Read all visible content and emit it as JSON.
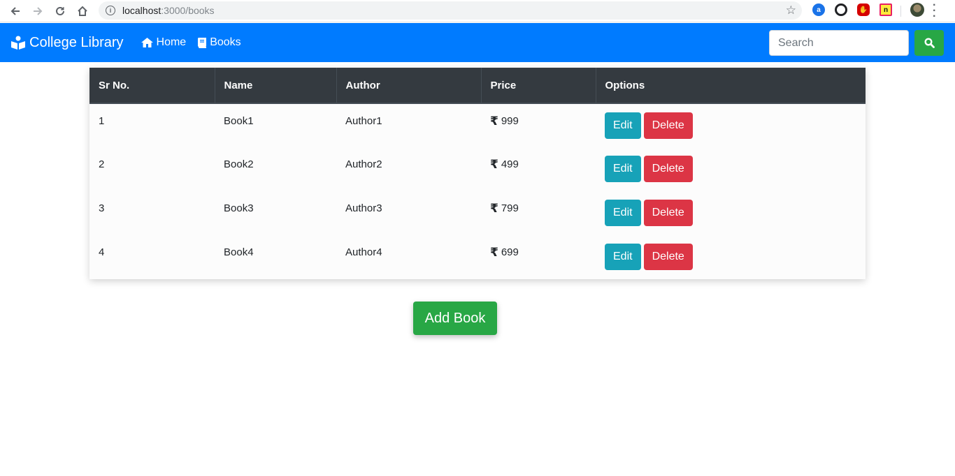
{
  "browser": {
    "url_host": "localhost",
    "url_path": ":3000/books",
    "back_icon": "back-arrow-icon",
    "forward_icon": "forward-arrow-icon",
    "reload_icon": "reload-icon",
    "home_icon": "home-icon",
    "info_icon": "info-icon",
    "bookmark_icon": "star-icon",
    "extension_1_label": "a",
    "extension_4_label": "n"
  },
  "navbar": {
    "brand": "College Library",
    "links": [
      {
        "label": "Home",
        "icon": "home-icon"
      },
      {
        "label": "Books",
        "icon": "book-icon"
      }
    ],
    "search": {
      "placeholder": "Search",
      "value": ""
    },
    "accent": "#007bff"
  },
  "table": {
    "headers": [
      "Sr No.",
      "Name",
      "Author",
      "Price",
      "Options"
    ],
    "currency_symbol": "₹",
    "rows": [
      {
        "sr": "1",
        "name": "Book1",
        "author": "Author1",
        "price": "999"
      },
      {
        "sr": "2",
        "name": "Book2",
        "author": "Author2",
        "price": "499"
      },
      {
        "sr": "3",
        "name": "Book3",
        "author": "Author3",
        "price": "799"
      },
      {
        "sr": "4",
        "name": "Book4",
        "author": "Author4",
        "price": "699"
      }
    ],
    "edit_label": "Edit",
    "delete_label": "Delete"
  },
  "add_button_label": "Add Book",
  "colors": {
    "success": "#28a745",
    "info": "#17a2b8",
    "danger": "#dc3545",
    "dark": "#343a40"
  }
}
